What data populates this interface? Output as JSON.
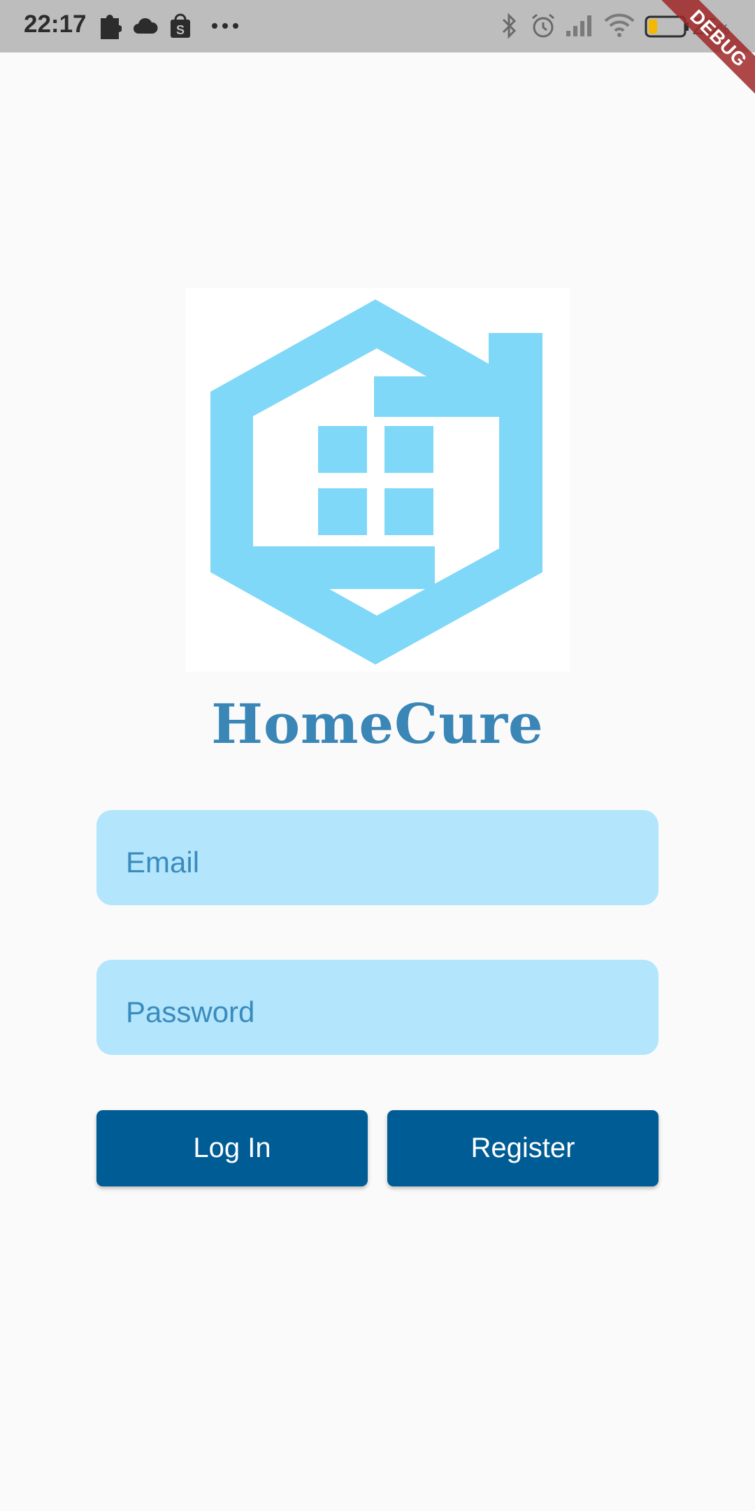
{
  "status_bar": {
    "time": "22:17",
    "battery_percent": "25",
    "battery_unit": "%",
    "icons": [
      "puzzle-icon",
      "cloud-icon",
      "shopping-bag-icon",
      "more-dots-icon",
      "bluetooth-icon",
      "alarm-icon",
      "signal-icon",
      "wifi-icon",
      "battery-icon"
    ]
  },
  "debug_banner": {
    "label": "DEBUG"
  },
  "logo": {
    "icon": "house-hexagon-logo",
    "color": "#80d8f8"
  },
  "app": {
    "title": "HomeCure"
  },
  "form": {
    "email_placeholder": "Email",
    "password_placeholder": "Password",
    "login_label": "Log In",
    "register_label": "Register"
  },
  "colors": {
    "title": "#3a86b6",
    "field_background": "#b3e5fc",
    "button_background": "#005c94",
    "page_background": "#fafafa"
  }
}
